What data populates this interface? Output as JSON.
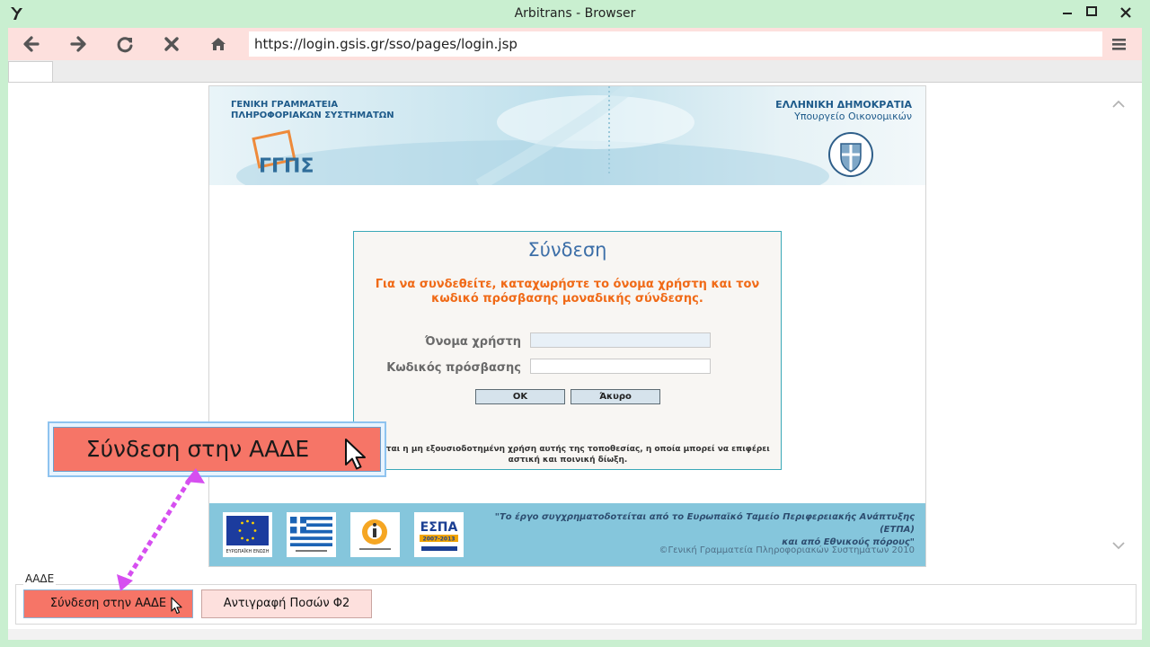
{
  "window": {
    "title": "Arbitrans - Browser",
    "controls": [
      "minimize",
      "maximize",
      "close"
    ]
  },
  "toolbar": {
    "icons": [
      "back-arrow-icon",
      "forward-arrow-icon",
      "refresh-icon",
      "stop-icon",
      "home-icon",
      "menu-icon"
    ],
    "url": "https://login.gsis.gr/sso/pages/login.jsp"
  },
  "page": {
    "banner": {
      "left_line1": "ΓΕΝΙΚΗ ΓΡΑΜΜΑΤΕΙΑ",
      "left_line2": "ΠΛΗΡΟΦΟΡΙΑΚΩΝ ΣΥΣΤΗΜΑΤΩΝ",
      "right_line1": "ΕΛΛΗΝΙΚΗ ΔΗΜΟΚΡΑΤΙΑ",
      "right_line2": "Υπουργείο Οικονομικών"
    },
    "login": {
      "title": "Σύνδεση",
      "description": "Για να συνδεθείτε, καταχωρήστε το όνομα χρήστη και τον κωδικό πρόσβασης μοναδικής σύνδεσης.",
      "username_label": "Όνομα χρήστη",
      "username_value": "",
      "password_label": "Κωδικός πρόσβασης",
      "password_value": "",
      "ok_label": "ΟΚ",
      "cancel_label": "Άκυρο",
      "warning_line1": "ρεύεται η μη εξουσιοδοτημένη χρήση αυτής της τοποθεσίας, η οποία μπορεί να επιφέρει",
      "warning_line2": "αστική και ποινική δίωξη."
    },
    "footer": {
      "quote_line1": "\"Το έργο συγχρηματοδοτείται από το Ευρωπαϊκό Ταμείο Περιφερειακής Ανάπτυξης (ΕΤΠΑ)",
      "quote_line2": "και από Εθνικούς πόρους\"",
      "copyright": "©Γενική Γραμματεία Πληροφοριακών Συστημάτων 2010",
      "logos": [
        "eu-flag-logo",
        "greek-flag-logo",
        "infosoc-logo",
        "espa-logo"
      ],
      "eu_caption": "ΕΥΡΩΠΑΪΚΗ ΕΝΩΣΗ",
      "espa_text": "ΕΣΠΑ",
      "espa_years": "2007-2013"
    }
  },
  "group": {
    "label": "ΑΑΔΕ",
    "login_button": "Σύνδεση στην ΑΑΔΕ",
    "copy_button": "Αντιγραφή Ποσών Φ2"
  },
  "callout": {
    "label": "Σύνδεση στην ΑΑΔΕ",
    "arrow_color": "#d64ff0"
  },
  "colors": {
    "titlebar": "#c9efd0",
    "toolbar": "#fde0dd",
    "accent_button": "#f67567",
    "banner_text": "#1d5a8a",
    "footer_band": "#85c6dc",
    "login_description": "#f06a17"
  }
}
